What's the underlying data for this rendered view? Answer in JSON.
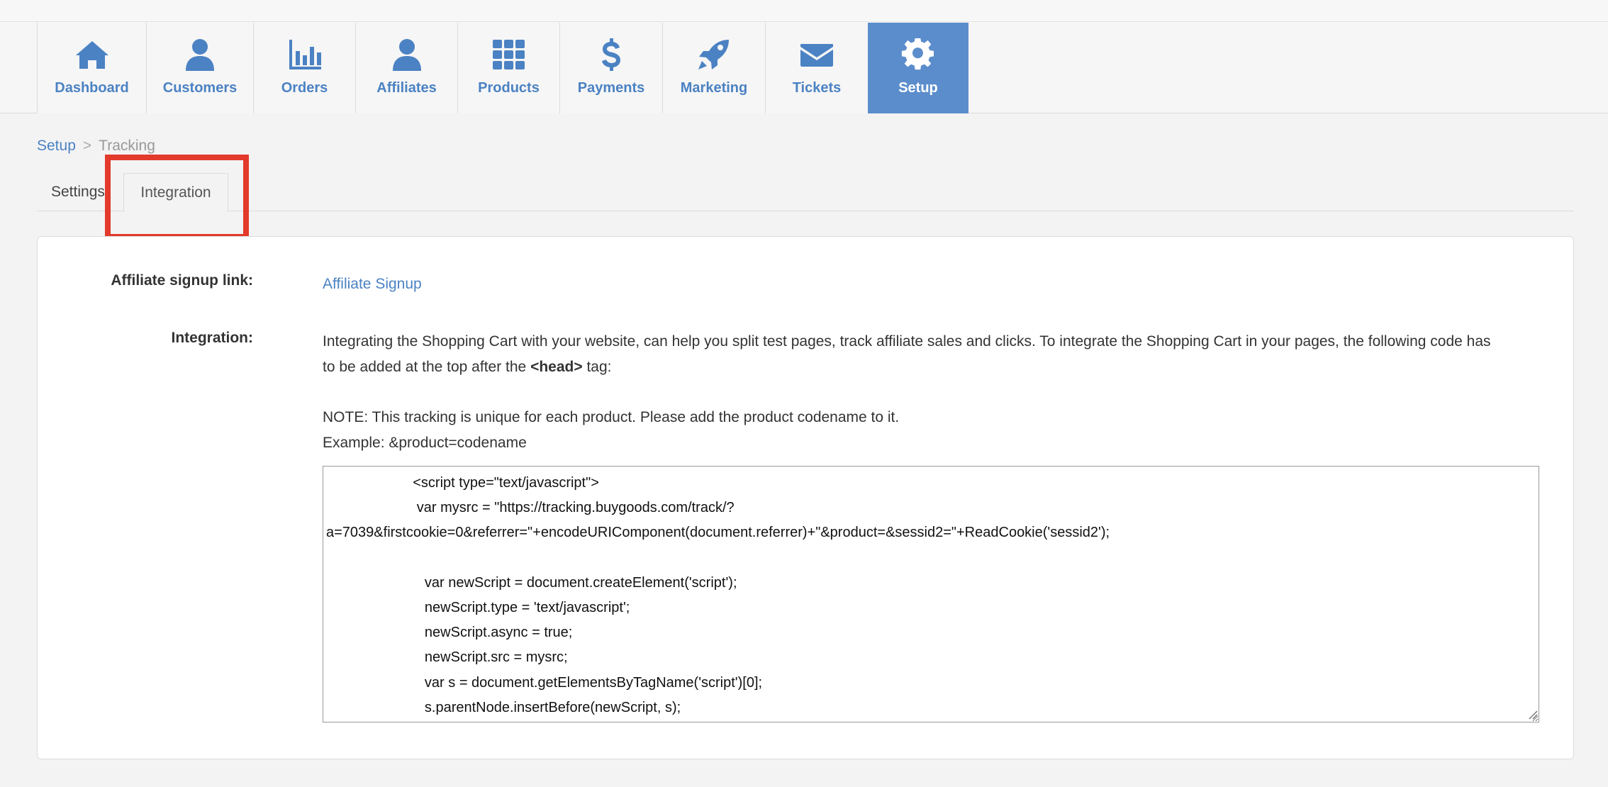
{
  "nav": {
    "items": [
      {
        "label": "Dashboard",
        "icon": "home-icon",
        "active": false
      },
      {
        "label": "Customers",
        "icon": "user-icon",
        "active": false
      },
      {
        "label": "Orders",
        "icon": "bar-chart-icon",
        "active": false
      },
      {
        "label": "Affiliates",
        "icon": "user-icon",
        "active": false
      },
      {
        "label": "Products",
        "icon": "grid-icon",
        "active": false
      },
      {
        "label": "Payments",
        "icon": "dollar-icon",
        "active": false
      },
      {
        "label": "Marketing",
        "icon": "rocket-icon",
        "active": false
      },
      {
        "label": "Tickets",
        "icon": "envelope-icon",
        "active": false
      },
      {
        "label": "Setup",
        "icon": "gear-icon",
        "active": true
      }
    ]
  },
  "breadcrumb": {
    "root": "Setup",
    "separator": ">",
    "current": "Tracking"
  },
  "tabs": {
    "settings": "Settings",
    "integration": "Integration"
  },
  "form": {
    "signup_label": "Affiliate signup link:",
    "signup_link": "Affiliate Signup",
    "integration_label": "Integration:",
    "description_1": "Integrating the Shopping Cart with your website, can help you split test pages, track affiliate sales and clicks. To integrate the Shopping Cart in your pages, the following code has",
    "description_2_pre": "to be added at the top after the ",
    "description_2_tag": "<head>",
    "description_2_post": " tag:",
    "note": "NOTE: This tracking is unique for each product. Please add the product codename to it.",
    "example": "Example: &product=codename",
    "code": "                      <script type=\"text/javascript\">\n                       var mysrc = \"https://tracking.buygoods.com/track/?\na=7039&firstcookie=0&referrer=\"+encodeURIComponent(document.referrer)+\"&product=&sessid2=\"+ReadCookie('sessid2');\n\n                         var newScript = document.createElement('script');\n                         newScript.type = 'text/javascript';\n                         newScript.async = true;\n                         newScript.src = mysrc;\n                         var s = document.getElementsByTagName('script')[0];\n                         s.parentNode.insertBefore(newScript, s);"
  },
  "colors": {
    "accent": "#4b82c3",
    "active_tab": "#5b8dcc",
    "highlight": "#e33a2b"
  }
}
